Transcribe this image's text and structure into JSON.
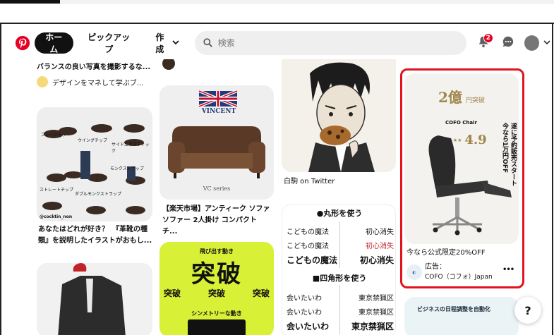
{
  "nav": {
    "home": "ホーム",
    "pickup": "ピックアップ",
    "create": "作成",
    "search_placeholder": "検索",
    "notification_count": "2"
  },
  "pins": {
    "col1_top_title": "バランスの良い写真を撮影するな...",
    "col1_top_creator": "デザインをマネして学ぶブ...",
    "shoe_labels": {
      "plain": "プレーントゥ",
      "wing": "ウイングチップ",
      "side": "サイドエラスティック",
      "monk": "モンクストラップ",
      "double": "ダブルモンクストラップ",
      "straight": "ストレートチップ",
      "handle": "@cocktin_non"
    },
    "col1_mid_title": "あなたはどれが好き？　『革靴の種類』を説明したイラストがおもし...",
    "col2_brand": "VINCENT",
    "col2_caption": "VC series",
    "col2_title": "【楽天市場】アンティーク ソファ ソファー 2人掛け コンパクト チ...",
    "col2_poster_sub1": "飛び出す動き",
    "col2_poster_big": "突破",
    "col2_poster_row": [
      "突破",
      "突破",
      "突破"
    ],
    "col2_poster_sub2": "シンメトリーな動き",
    "col3_caption": "白駒 on Twitter",
    "col3_font_head": "丸形を使う",
    "col3_font_rows": [
      [
        "こどもの魔法",
        "初心消失"
      ],
      [
        "こどもの魔法",
        "初心消失"
      ],
      [
        "こどもの魔法",
        "初心消失"
      ]
    ],
    "col3_font_head2": "四角形を使う",
    "col3_font_rows2": [
      [
        "会いたいわ",
        "東京禁猟区"
      ],
      [
        "会いたいわ",
        "東京禁猟区"
      ],
      [
        "会いたいわ",
        "東京禁猟区"
      ]
    ],
    "ad_award": "2億",
    "ad_award_suffix": "円突破",
    "ad_brand": "COFO Chair",
    "ad_rating": "4.9",
    "ad_vertical": "遂に予約販売スタート 今なら1万円OFF",
    "ad_title": "今なら公式限定20%OFF",
    "ad_label": "広告：",
    "ad_advertiser": "COFO（コフォ）Japan",
    "ad_more": "•••",
    "col4_bottom_text": "ビジネスの日程調整を自動化"
  },
  "help": "?",
  "colors": {
    "brand": "#e60023",
    "highlight": "#e0131f",
    "poster": "#d8f036"
  }
}
